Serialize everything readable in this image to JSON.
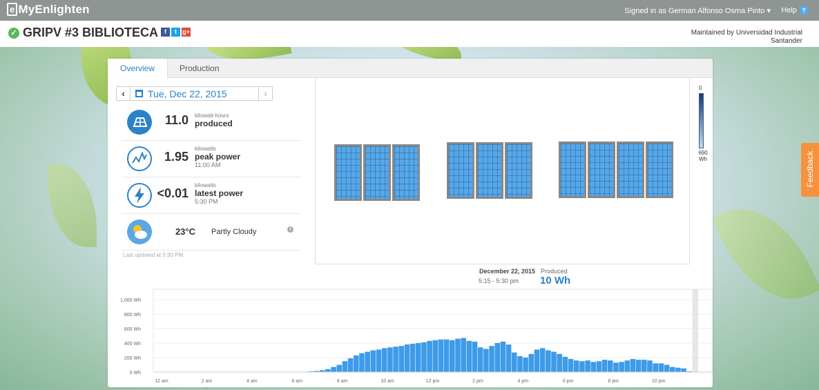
{
  "topbar": {
    "logo_bracket": "e",
    "logo_text": "MyEnlighten",
    "signed_in": "Signed in as German Alfonso Osma Pinto",
    "help": "Help"
  },
  "site": {
    "title": "GRIPV #3 BIBLIOTECA",
    "maintained_by": "Maintained by Universidad Industrial Santander"
  },
  "tabs": [
    {
      "label": "Overview",
      "active": true
    },
    {
      "label": "Production",
      "active": false
    }
  ],
  "date_nav": {
    "date": "Tue, Dec 22, 2015"
  },
  "stats": {
    "produced": {
      "value": "11.0",
      "unit": "kilowatt-hours",
      "label": "produced"
    },
    "peak": {
      "value": "1.95",
      "unit": "kilowatts",
      "label": "peak power",
      "time": "11:00 AM"
    },
    "latest": {
      "value": "<0.01",
      "unit": "kilowatts",
      "label": "latest power",
      "time": "5:30 PM"
    },
    "weather": {
      "temp": "23°C",
      "condition": "Partly Cloudy"
    }
  },
  "last_updated": "Last updated at 5:30 PM.",
  "legend": {
    "min": "0",
    "max": "690",
    "unit": "Wh"
  },
  "tooltip": {
    "date": "December 22, 2015",
    "time": "5:15 - 5:30 pm",
    "label": "Produced",
    "value": "10 Wh"
  },
  "feedback": "Feedback",
  "colors": {
    "accent": "#2b82c9",
    "bar": "#3d9be9",
    "feedback": "#f7913d",
    "ok": "#5cb85c"
  },
  "chart_data": {
    "type": "bar",
    "x_tick_labels": [
      "12 am",
      "2 am",
      "4 am",
      "6 am",
      "8 am",
      "10 am",
      "12 pm",
      "2 pm",
      "4 pm",
      "6 pm",
      "8 pm",
      "10 pm"
    ],
    "y_tick_labels": [
      "1,000 Wh",
      "800 Wh",
      "600 Wh",
      "400 Wh",
      "200 Wh",
      "0 Wh"
    ],
    "ylim": [
      0,
      1000
    ],
    "interval_minutes": 15,
    "start_time": "6:15 am",
    "values": [
      5,
      10,
      15,
      25,
      40,
      70,
      100,
      150,
      190,
      230,
      260,
      280,
      300,
      310,
      330,
      340,
      350,
      360,
      380,
      390,
      400,
      410,
      430,
      440,
      450,
      450,
      440,
      460,
      470,
      430,
      420,
      340,
      320,
      360,
      400,
      420,
      380,
      270,
      220,
      200,
      250,
      310,
      330,
      300,
      280,
      250,
      210,
      180,
      160,
      150,
      160,
      140,
      150,
      170,
      160,
      130,
      140,
      160,
      180,
      170,
      170,
      160,
      120,
      120,
      100,
      70,
      60,
      50,
      10
    ],
    "highlight": "5:15 - 5:30 pm"
  }
}
